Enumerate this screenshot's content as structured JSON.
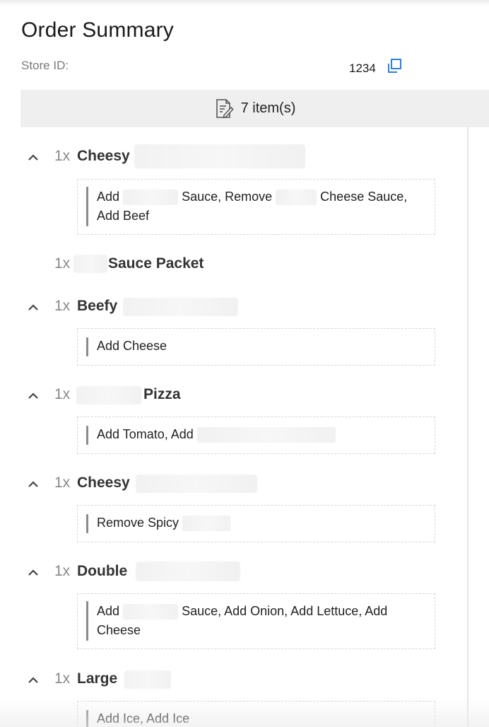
{
  "header": {
    "title": "Order Summary",
    "store_label": "Store ID:",
    "store_value": "1234",
    "copy_icon": "copy-icon"
  },
  "summary": {
    "items_label": "7 item(s)",
    "icon": "document-edit-icon"
  },
  "colors": {
    "accent": "#2f80d8",
    "bar_bg": "#efefef",
    "qty": "#888888"
  },
  "items": [
    {
      "qty": "1x",
      "name": "Cheesy",
      "modifiers": {
        "line1": [
          "Add",
          "Sauce, Remove",
          "Cheese Sauce,"
        ],
        "line2": "Add Beef"
      }
    },
    {
      "qty": "1x",
      "name": "Sauce Packet"
    },
    {
      "qty": "1x",
      "name": "Beefy",
      "modifiers": {
        "line1": "Add Cheese"
      }
    },
    {
      "qty": "1x",
      "name": "Pizza",
      "modifiers": {
        "line1": "Add Tomato, Add"
      }
    },
    {
      "qty": "1x",
      "name": "Cheesy",
      "modifiers": {
        "line1": "Remove Spicy"
      }
    },
    {
      "qty": "1x",
      "name": "Double",
      "modifiers": {
        "line1": [
          "Add",
          "Sauce, Add Onion, Add Lettuce, Add"
        ],
        "line2": "Cheese"
      }
    },
    {
      "qty": "1x",
      "name": "Large",
      "modifiers": {
        "line1": "Add Ice, Add Ice"
      }
    }
  ]
}
